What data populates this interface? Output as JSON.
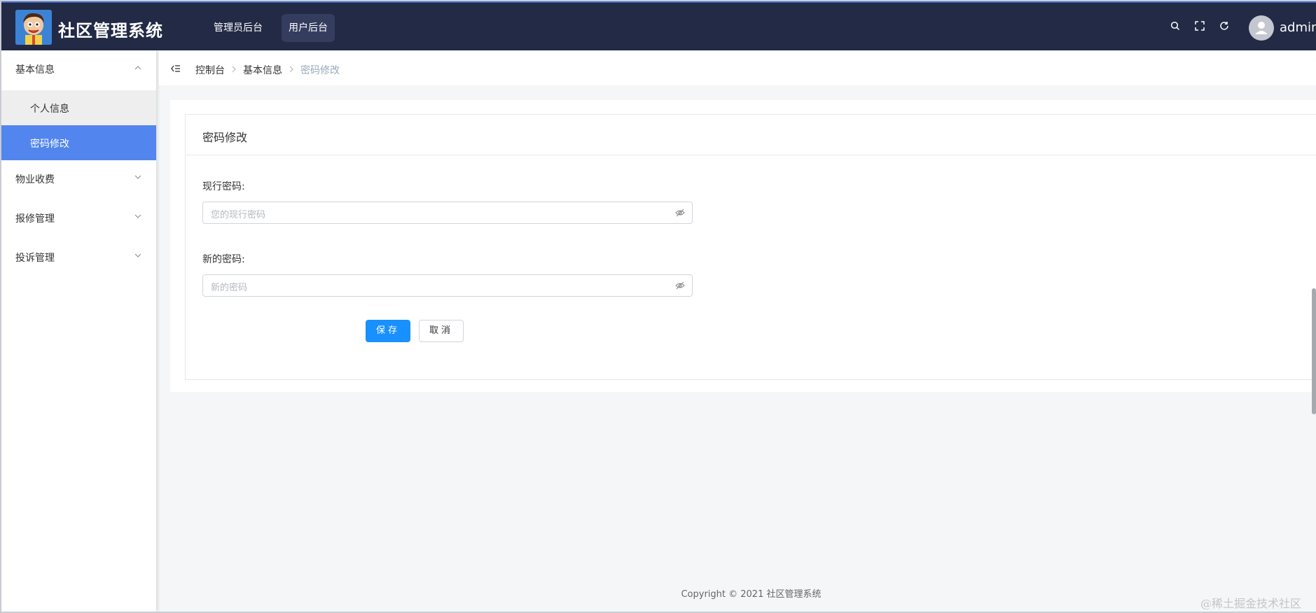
{
  "header": {
    "app_title": "社区管理系统",
    "nav": [
      "管理员后台",
      "用户后台"
    ],
    "active_nav": "用户后台",
    "username": "admin",
    "icons": [
      "search-icon",
      "fullscreen-icon",
      "refresh-icon"
    ]
  },
  "sidebar": {
    "groups": [
      {
        "label": "基本信息",
        "expanded": true,
        "items": [
          "个人信息",
          "密码修改"
        ],
        "active_item": "密码修改"
      },
      {
        "label": "物业收费",
        "expanded": false
      },
      {
        "label": "报修管理",
        "expanded": false
      },
      {
        "label": "投诉管理",
        "expanded": false
      }
    ]
  },
  "breadcrumb": [
    "控制台",
    "基本信息",
    "密码修改"
  ],
  "form": {
    "title": "密码修改",
    "fields": [
      {
        "label": "现行密码:",
        "placeholder": "您的现行密码"
      },
      {
        "label": "新的密码:",
        "placeholder": "新的密码"
      }
    ],
    "save_label": "保存",
    "cancel_label": "取消"
  },
  "footer": {
    "copyright": "Copyright © 2021 社区管理系统"
  },
  "watermark": "@稀土掘金技术社区",
  "colors": {
    "header_bg": "#222a45",
    "active_menu": "#5286ee",
    "primary": "#1890ff"
  }
}
